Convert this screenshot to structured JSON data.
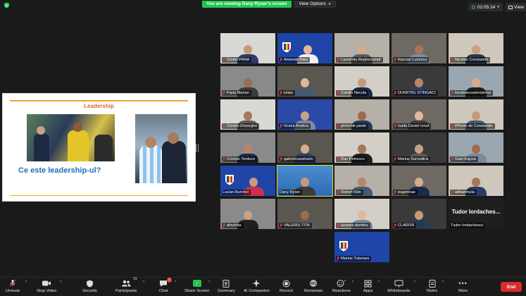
{
  "banner": {
    "viewing_text": "You are viewing Dany Ryser's screen",
    "view_options_label": "View Options"
  },
  "header": {
    "timer": "02:05:14",
    "view_label": "View"
  },
  "presentation": {
    "title": "Leadership",
    "question": "Ce este leadership-ul?"
  },
  "participants": [
    {
      "name": "Costel PANA",
      "muted": true
    },
    {
      "name": "Amanda Paiu",
      "muted": true
    },
    {
      "name": "Laurentiu Reghecampf",
      "muted": true
    },
    {
      "name": "Razvan Lucescu",
      "muted": true
    },
    {
      "name": "Nicolae Constantin",
      "muted": true
    },
    {
      "name": "Pana Marian",
      "muted": true
    },
    {
      "name": "iulian",
      "muted": true
    },
    {
      "name": "Catalin Necula",
      "muted": true
    },
    {
      "name": "DUMITRU STINGACI",
      "muted": true
    },
    {
      "name": "bordeanuvalerialorut",
      "muted": true
    },
    {
      "name": "Contra Gheorghe",
      "muted": true
    },
    {
      "name": "Gratut Aristica",
      "muted": true
    },
    {
      "name": "pirtochik paolo",
      "muted": true
    },
    {
      "name": "Isaila Daniel Ionut",
      "muted": true
    },
    {
      "name": "iPhone de Constantin",
      "muted": true
    },
    {
      "name": "Cristian Tentiure",
      "muted": true
    },
    {
      "name": "gabrielcaramarin",
      "muted": true
    },
    {
      "name": "Dan Petrescu",
      "muted": true
    },
    {
      "name": "Marius Sumudica",
      "muted": true
    },
    {
      "name": "Gabi Kajcsa",
      "muted": true
    },
    {
      "name": "Lucian Burchel",
      "muted": false
    },
    {
      "name": "Dany Ryser",
      "muted": false
    },
    {
      "name": "Robert Kilin",
      "muted": true
    },
    {
      "name": "eugennae",
      "muted": true
    },
    {
      "name": "adrianmuta",
      "muted": true
    },
    {
      "name": "alinchita",
      "muted": true
    },
    {
      "name": "VALERIU TITA",
      "muted": true
    },
    {
      "name": "uzunea dumitru",
      "muted": true
    },
    {
      "name": "CLAROR",
      "muted": true
    },
    {
      "name": "Tudor Iordachescu",
      "muted": false,
      "display_text": "Tudor Iordaches..."
    },
    {
      "name": "Marius Tutunaru",
      "muted": true
    }
  ],
  "toolbar": {
    "unmute": "Unmute",
    "stop_video": "Stop Video",
    "security": "Security",
    "participants": "Participants",
    "participants_count": "31",
    "chat": "Chat",
    "chat_badge": "1",
    "share_screen": "Share Screen",
    "summary": "Summary",
    "ai_companion": "AI Companion",
    "record": "Record",
    "interpretation": "Romanian",
    "reactions": "Reactions",
    "apps": "Apps",
    "whiteboards": "Whiteboards",
    "notes": "Notes",
    "more": "More",
    "end": "End"
  },
  "colors": {
    "accent_green": "#23c552",
    "active_speaker": "#d9e34a",
    "end_red": "#d92b2b",
    "slide_title": "#e4612b",
    "slide_question": "#1f6fb8"
  }
}
